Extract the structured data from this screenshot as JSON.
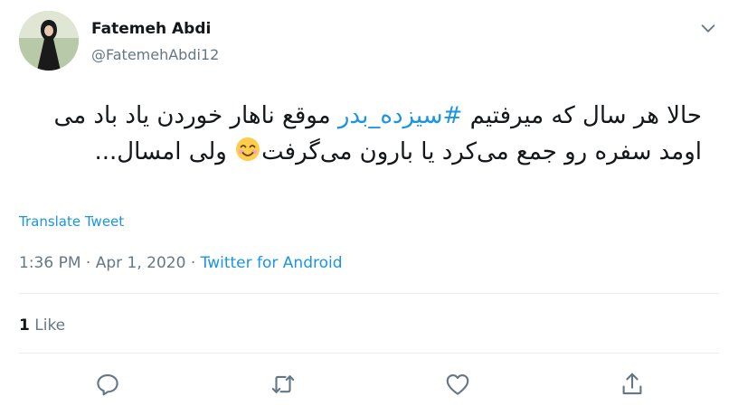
{
  "author": {
    "name": "Fatemeh Abdi",
    "handle": "@FatemehAbdi12"
  },
  "tweet": {
    "text_before": "حالا هر سال که میرفتیم ",
    "hashtag": "#سیزده_بدر",
    "text_mid": " موقع ناهار خوردن یاد باد می اومد سفره رو جمع می‌کرد یا بارون می‌گرفت",
    "text_after": " ولی امسال..."
  },
  "translate_label": "Translate Tweet",
  "meta": {
    "time": "1:36 PM",
    "sep1": " · ",
    "date": "Apr 1, 2020",
    "sep2": " · ",
    "source": "Twitter for Android"
  },
  "stats": {
    "like_count": "1",
    "like_label": "Like"
  },
  "icons": [
    "chevron-down-icon",
    "reply-icon",
    "retweet-icon",
    "like-icon",
    "share-icon",
    "smiling-emoji-icon"
  ],
  "colors": {
    "link": "#1b95e0",
    "muted": "#657786",
    "text": "#14171a",
    "divider": "#e6ecf0"
  }
}
